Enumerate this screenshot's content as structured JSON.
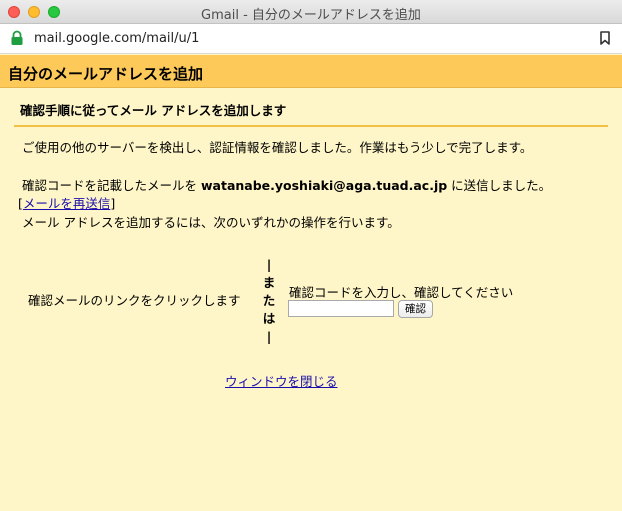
{
  "window": {
    "title": "Gmail - 自分のメールアドレスを追加"
  },
  "addressbar": {
    "url": "mail.google.com/mail/u/1"
  },
  "page": {
    "title": "自分のメールアドレスを追加",
    "section_heading": "確認手順に従ってメール アドレスを追加します",
    "detected_text": "ご使用の他のサーバーを検出し、認証情報を確認しました。作業はもう少しで完了します。",
    "sent_prefix": "確認コードを記載したメールを ",
    "email": "watanabe.yoshiaki@aga.tuad.ac.jp",
    "sent_suffix": " に送信しました。",
    "resend_open": "[",
    "resend_link": "メールを再送信",
    "resend_close": "]",
    "instruction": "メール アドレスを追加するには、次のいずれかの操作を行います。"
  },
  "options": {
    "left_label": "確認メールのリンクをクリックします",
    "or_chars": [
      "|",
      "ま",
      "た",
      "は",
      "|"
    ],
    "right_label": "確認コードを入力し、確認してください",
    "code_value": "",
    "verify_button": "確認"
  },
  "footer": {
    "close_link": "ウィンドウを閉じる"
  },
  "colors": {
    "header_bg": "#fdca5a",
    "content_bg": "#fef6c8",
    "divider": "#f2c043",
    "link": "#1a0dab"
  }
}
